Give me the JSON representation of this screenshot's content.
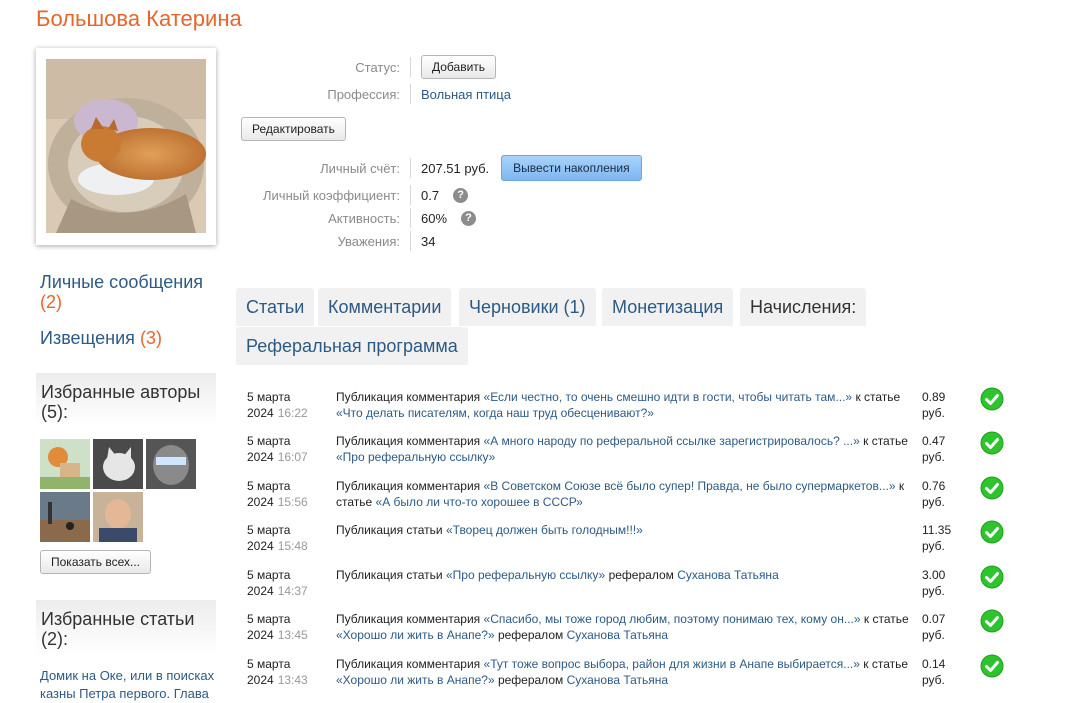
{
  "profile": {
    "name": "Большова Катерина"
  },
  "info": {
    "status_label": "Статус:",
    "status_button": "Добавить",
    "profession_label": "Профессия:",
    "profession_value": "Вольная птица",
    "edit_button": "Редактировать",
    "account_label": "Личный счёт:",
    "account_value": "207.51 руб.",
    "withdraw_button": "Вывести накопления",
    "coef_label": "Личный коэффициент:",
    "coef_value": "0.7",
    "activity_label": "Активность:",
    "activity_value": "60%",
    "respect_label": "Уважения:",
    "respect_value": "34",
    "help_glyph": "?"
  },
  "sidebar": {
    "messages_label": "Личные сообщения",
    "messages_count": "(2)",
    "notices_label": "Извещения",
    "notices_count": "(3)",
    "fav_authors_title": "Избранные авторы",
    "fav_authors_count": "(5):",
    "show_all_button": "Показать всех...",
    "fav_articles_title": "Избранные статьи",
    "fav_articles_count": "(2):",
    "fav_article_1": "Домик на Оке, или в поисках казны Петра первого. Глава"
  },
  "tabs": [
    {
      "label": "Статьи"
    },
    {
      "label": "Комментарии"
    },
    {
      "label": "Черновики (1)"
    },
    {
      "label": "Монетизация"
    },
    {
      "label": "Начисления:"
    },
    {
      "label": "Реферальная программа"
    }
  ],
  "transactions": [
    {
      "date": "5 марта 2024",
      "time": "16:22",
      "type": "Публикация комментария",
      "item": "«Если честно, то очень смешно идти в гости, чтобы читать там...»",
      "link_word": "к статье",
      "article": "«Что делать писателям, когда наш труд обесценивают?»",
      "ref_word": "",
      "referral": "",
      "amount": "0.89 руб."
    },
    {
      "date": "5 марта 2024",
      "time": "16:07",
      "type": "Публикация комментария",
      "item": "«А много народу по реферальной ссылке зарегистрировалось? ...»",
      "link_word": "к статье",
      "article": "«Про реферальную ссылку»",
      "ref_word": "",
      "referral": "",
      "amount": "0.47 руб."
    },
    {
      "date": "5 марта 2024",
      "time": "15:56",
      "type": "Публикация комментария",
      "item": "«В Советском Союзе всё было супер! Правда, не было супермаркетов...»",
      "link_word": "к статье",
      "article": "«А было ли что-то хорошее в СССР»",
      "ref_word": "",
      "referral": "",
      "amount": "0.76 руб."
    },
    {
      "date": "5 марта 2024",
      "time": "15:48",
      "type": "Публикация статьи",
      "item": "«Творец должен быть голодным!!!»",
      "link_word": "",
      "article": "",
      "ref_word": "",
      "referral": "",
      "amount": "11.35 руб."
    },
    {
      "date": "5 марта 2024",
      "time": "14:37",
      "type": "Публикация статьи",
      "item": "«Про реферальную ссылку»",
      "link_word": "",
      "article": "",
      "ref_word": "рефералом",
      "referral": "Суханова Татьяна",
      "amount": "3.00 руб."
    },
    {
      "date": "5 марта 2024",
      "time": "13:45",
      "type": "Публикация комментария",
      "item": "«Спасибо, мы тоже город любим, поэтому понимаю тех, кому он...»",
      "link_word": "к статье",
      "article": "«Хорошо ли жить в Анапе?»",
      "ref_word": "рефералом",
      "referral": "Суханова Татьяна",
      "amount": "0.07 руб."
    },
    {
      "date": "5 марта 2024",
      "time": "13:43",
      "type": "Публикация комментария",
      "item": "«Тут тоже вопрос выбора, район для жизни в Анапе выбирается...»",
      "link_word": "к статье",
      "article": "«Хорошо ли жить в Анапе?»",
      "ref_word": "рефералом",
      "referral": "Суханова Татьяна",
      "amount": "0.14 руб."
    }
  ],
  "colors": {
    "name": "#e8652b",
    "link": "#2c5a85",
    "check": "#2ec42e"
  },
  "icons": {
    "status": "check-circle-icon",
    "help": "question-circle-icon"
  }
}
